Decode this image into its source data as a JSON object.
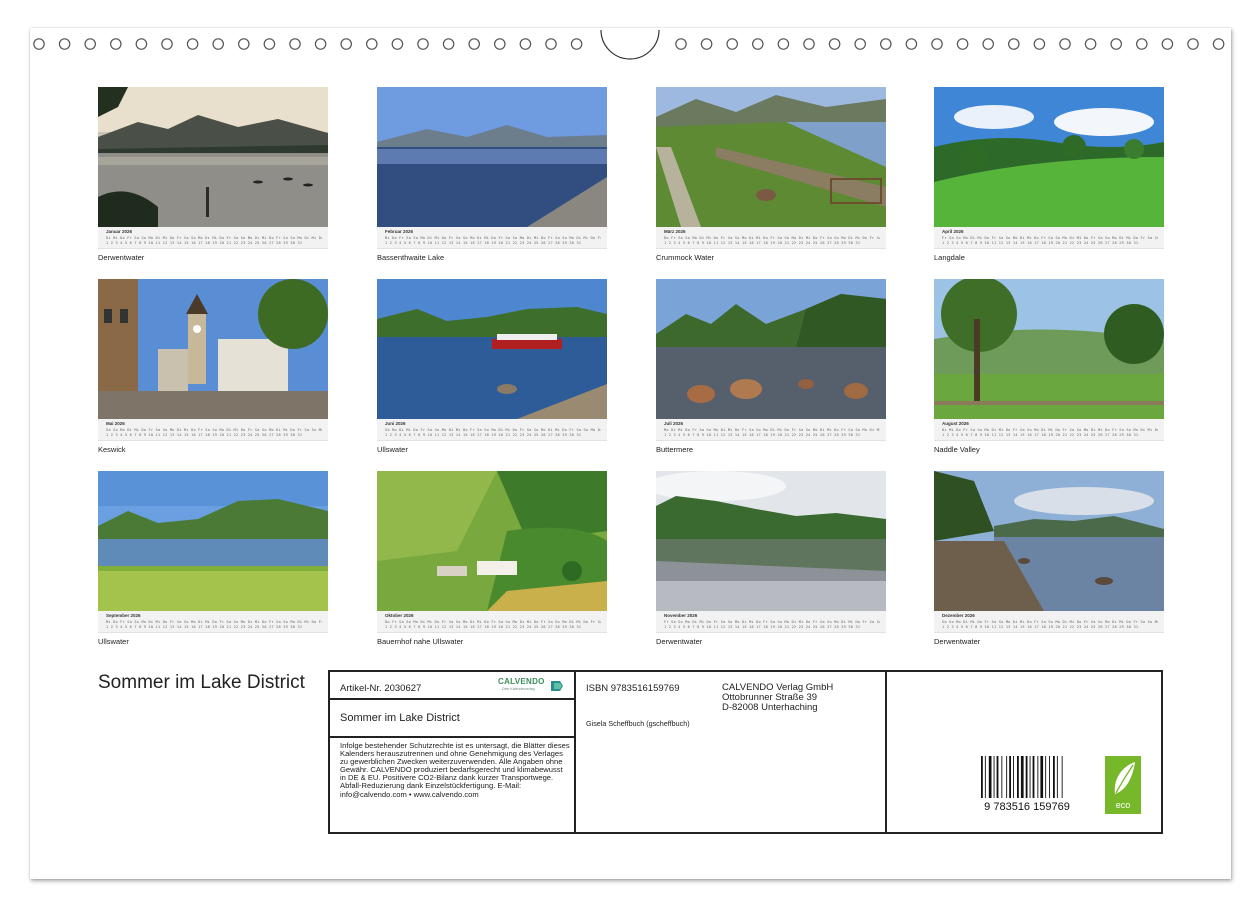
{
  "months": [
    {
      "month": "Januar 2026",
      "caption": "Derwentwater",
      "scene": "lake-dusk"
    },
    {
      "month": "Februar 2026",
      "caption": "Bassenthwaite Lake",
      "scene": "lake-blue"
    },
    {
      "month": "März 2026",
      "caption": "Crummock Water",
      "scene": "lake-path"
    },
    {
      "month": "April 2026",
      "caption": "Langdale",
      "scene": "meadow"
    },
    {
      "month": "Mai 2026",
      "caption": "Keswick",
      "scene": "town"
    },
    {
      "month": "Juni 2026",
      "caption": "Ullswater",
      "scene": "lake-boats"
    },
    {
      "month": "Juli 2026",
      "caption": "Buttermere",
      "scene": "lake-rocks"
    },
    {
      "month": "August 2026",
      "caption": "Naddle Valley",
      "scene": "valley-trees"
    },
    {
      "month": "September 2026",
      "caption": "Ullswater",
      "scene": "lake-flowers"
    },
    {
      "month": "Oktober 2026",
      "caption": "Bauernhof nahe Ullswater",
      "scene": "farm"
    },
    {
      "month": "November 2026",
      "caption": "Derwentwater",
      "scene": "lake-reflection"
    },
    {
      "month": "Dezember 2026",
      "caption": "Derwentwater",
      "scene": "lake-shore"
    }
  ],
  "calendar_title": "Sommer im Lake District",
  "info": {
    "article_nr": "Artikel-Nr. 2030627",
    "logo_brand": "CALVENDO",
    "logo_tagline": "Dein Kalenderverlag",
    "title": "Sommer im Lake District",
    "legal_text": "Infolge bestehender Schutzrechte ist es untersagt, die Blätter dieses Kalenders herauszutrennen und ohne Genehmigung des Verlages zu gewerblichen Zwecken weiterzuverwenden. Alle Angaben ohne Gewähr. CALVENDO produziert bedarfsgerecht und klimabewusst in DE & EU. Positivere CO2-Bilanz dank kurzer Transportwege. Abfall-Reduzierung dank Einzelstückfertigung. E-Mail: info@calvendo.com • www.calvendo.com",
    "isbn": "ISBN 9783516159769",
    "publisher_name": "CALVENDO Verlag GmbH",
    "publisher_street": "Ottobrunner Straße 39",
    "publisher_city": "D-82008 Unterhaching",
    "author": "Gisela Scheffbuch (gscheffbuch)",
    "barcode_digits": "9 783516 159769",
    "eco_label": "eco"
  },
  "colors": {
    "accent_green": "#3a8f5a",
    "eco_green": "#76b82a",
    "border": "#222222"
  }
}
